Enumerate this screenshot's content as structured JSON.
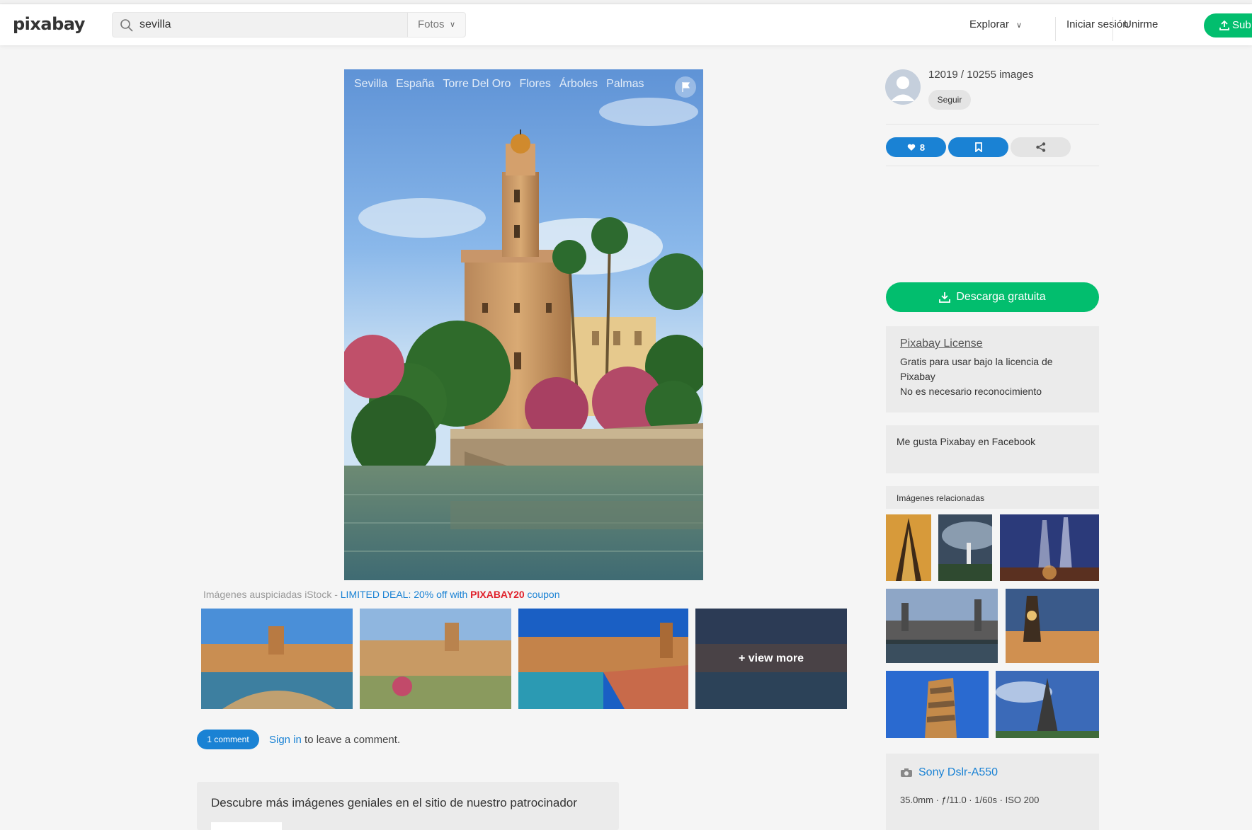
{
  "header": {
    "logo": "pixabay",
    "search_value": "sevilla",
    "search_type": "Fotos",
    "nav": {
      "explore": "Explorar",
      "login": "Iniciar sesión",
      "join": "Unirme",
      "upload": "Sub"
    }
  },
  "image": {
    "tags": [
      "Sevilla",
      "España",
      "Torre Del Oro",
      "Flores",
      "Árboles",
      "Palmas"
    ]
  },
  "sponsored": {
    "prefix": "Imágenes auspiciadas iStock - ",
    "deal": "LIMITED DEAL: 20% off with ",
    "code": "PIXABAY20",
    "suffix": " coupon",
    "view_more": "+ view more"
  },
  "comments": {
    "badge": "1 comment",
    "sign_in": "Sign in",
    "leave": " to leave a comment."
  },
  "sponsor_box": {
    "text": "Descubre más imágenes geniales en el sitio de nuestro patrocinador"
  },
  "sidebar": {
    "count": "12019 / 10255 images",
    "follow": "Seguir",
    "likes": "8",
    "download": "Descarga gratuita",
    "license_title": "Pixabay License",
    "license_line1": "Gratis para usar bajo la licencia de",
    "license_line2": "Pixabay",
    "license_line3": "No es necesario reconocimiento",
    "facebook": "Me gusta Pixabay en Facebook",
    "related": "Imágenes relacionadas",
    "camera": "Sony Dslr-A550",
    "camera_specs": "35.0mm · ƒ/11.0 · 1/60s · ISO 200"
  },
  "colors": {
    "accent_green": "#02be6e",
    "accent_blue": "#1a82d4",
    "coupon_red": "#e0212b"
  }
}
